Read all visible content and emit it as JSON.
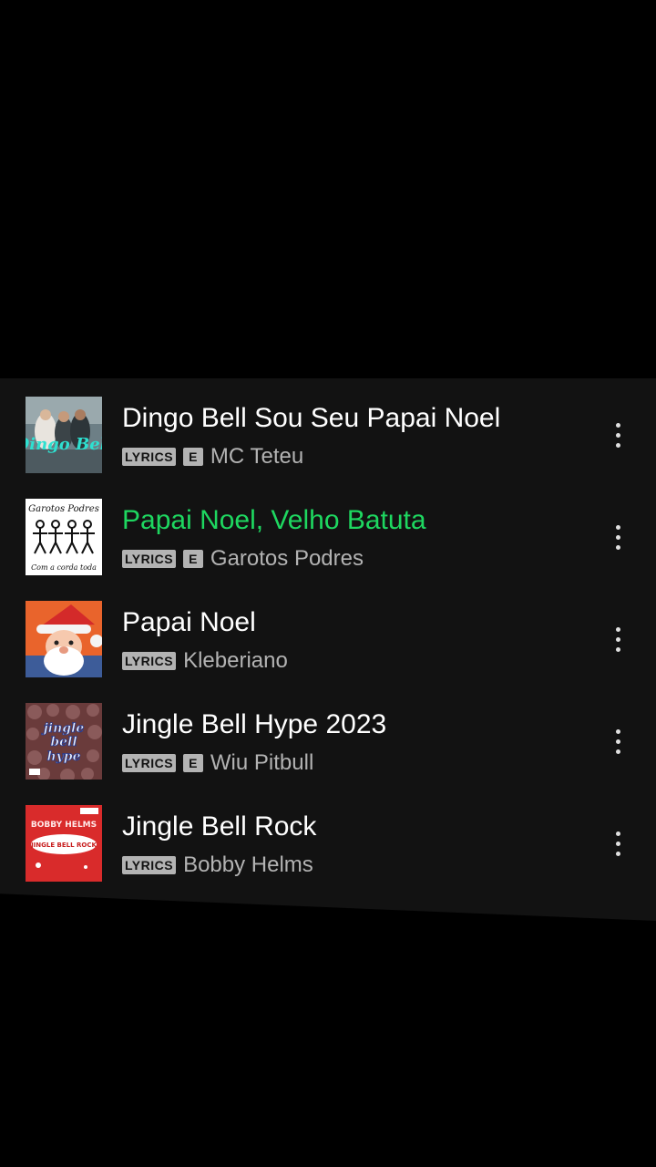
{
  "tracks": [
    {
      "title": "Dingo Bell Sou Seu Papai Noel",
      "lyrics_badge": "LYRICS",
      "explicit_badge": "E",
      "artist": "MC Teteu",
      "playing": false,
      "cover_icon": "dingo-bell-cover"
    },
    {
      "title": "Papai Noel, Velho Batuta",
      "lyrics_badge": "LYRICS",
      "explicit_badge": "E",
      "artist": "Garotos Podres",
      "playing": true,
      "cover_icon": "garotos-podres-cover"
    },
    {
      "title": "Papai Noel",
      "lyrics_badge": "LYRICS",
      "explicit_badge": null,
      "artist": "Kleberiano",
      "playing": false,
      "cover_icon": "santa-cover"
    },
    {
      "title": "Jingle Bell Hype 2023",
      "lyrics_badge": "LYRICS",
      "explicit_badge": "E",
      "artist": "Wiu Pitbull",
      "playing": false,
      "cover_icon": "jingle-bell-hype-cover"
    },
    {
      "title": "Jingle Bell Rock",
      "lyrics_badge": "LYRICS",
      "explicit_badge": null,
      "artist": "Bobby Helms",
      "playing": false,
      "cover_icon": "jingle-bell-rock-cover"
    }
  ],
  "cover_text": {
    "dingo": "Dingo Bell",
    "garotos_top": "Garotos Podres",
    "garotos_bottom": "Com a corda toda",
    "hype": [
      "jingle",
      "bell",
      "hype"
    ],
    "bobby_artist": "BOBBY HELMS",
    "bobby_title": "JINGLE BELL ROCK"
  },
  "colors": {
    "background": "#000000",
    "panel": "#121212",
    "title": "#ffffff",
    "playing": "#1ed760",
    "secondary": "#b3b3b3"
  }
}
